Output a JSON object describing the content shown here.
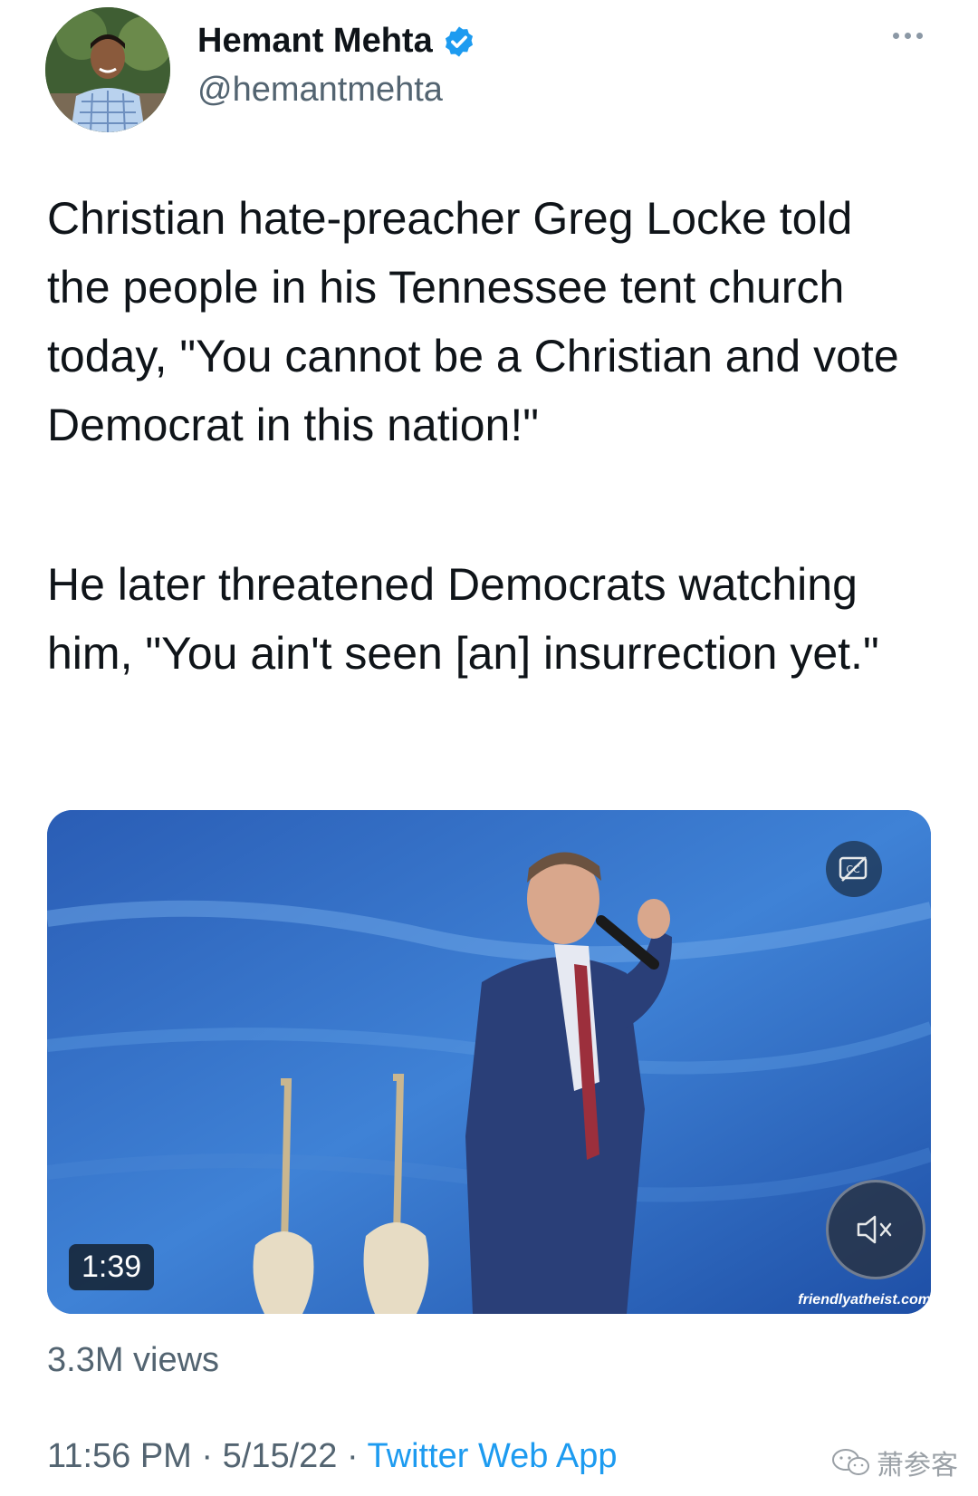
{
  "author": {
    "name": "Hemant Mehta",
    "handle": "@hemantmehta",
    "verified": true
  },
  "tweet": {
    "paragraph_1": "Christian hate-preacher Greg Locke told the people in his Tennessee tent church today, \"You cannot be a Christian and vote Democrat in this nation!\"",
    "paragraph_2": "He later threatened Democrats watching him, \"You ain't seen [an] insurrection yet.\""
  },
  "video": {
    "duration": "1:39",
    "watermark_site": "friendlyatheist.com",
    "captions_icon": "cc-icon",
    "mute_icon": "speaker-muted-icon"
  },
  "stats": {
    "views": "3.3M views"
  },
  "meta": {
    "time": "11:56 PM",
    "separator_1": " · ",
    "date": "5/15/22",
    "separator_2": " · ",
    "source": "Twitter Web App"
  },
  "brand_watermark": {
    "icon": "wechat-icon",
    "text": "萧参客"
  },
  "colors": {
    "text": "#0f1419",
    "secondary": "#536471",
    "link": "#1d9bf0",
    "verified": "#1d9bf0",
    "video_bg": "#2b5fb8"
  }
}
